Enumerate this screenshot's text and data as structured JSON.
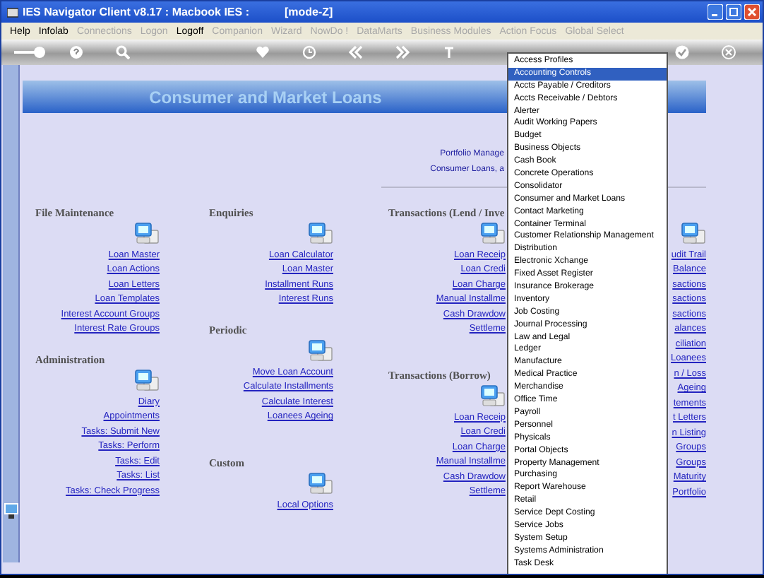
{
  "window": {
    "title": "IES Navigator Client v8.17 : Macbook IES :",
    "mode": "[mode-Z]"
  },
  "menu": [
    {
      "label": "Help",
      "disabled": false
    },
    {
      "label": "Infolab",
      "disabled": false
    },
    {
      "label": "Connections",
      "disabled": true
    },
    {
      "label": "Logon",
      "disabled": true
    },
    {
      "label": "Logoff",
      "disabled": false
    },
    {
      "label": "Companion",
      "disabled": true
    },
    {
      "label": "Wizard",
      "disabled": true
    },
    {
      "label": "NowDo !",
      "disabled": true
    },
    {
      "label": "DataMarts",
      "disabled": true
    },
    {
      "label": "Business Modules",
      "disabled": true
    },
    {
      "label": "Action Focus",
      "disabled": true
    },
    {
      "label": "Global Select",
      "disabled": true
    }
  ],
  "banner": {
    "title": "Consumer and Market Loans"
  },
  "info": [
    "Portfolio Manage",
    "Consumer Loans, a"
  ],
  "columns": [
    {
      "sections": [
        {
          "heading": "File Maintenance",
          "links": [
            "Loan Master",
            "Loan Actions",
            "Loan Letters",
            "Loan Templates",
            "Interest Account Groups",
            "Interest Rate Groups"
          ]
        },
        {
          "heading": "Administration",
          "links": [
            "Diary",
            "Appointments",
            "Tasks: Submit New",
            "Tasks: Perform",
            "Tasks: Edit",
            "Tasks: List",
            "Tasks: Check Progress"
          ]
        }
      ]
    },
    {
      "sections": [
        {
          "heading": "Enquiries",
          "links": [
            "Loan Calculator",
            "Loan Master",
            "Installment Runs",
            "Interest Runs"
          ]
        },
        {
          "heading": "Periodic",
          "links": [
            "Move Loan Account",
            "Calculate Installments",
            "Calculate Interest",
            "Loanees Ageing"
          ]
        },
        {
          "heading": "Custom",
          "links": [
            "Local Options"
          ]
        }
      ]
    },
    {
      "sections": [
        {
          "heading": "Transactions (Lend / Inve",
          "links": [
            "Loan Receip",
            "Loan Credi",
            "Loan Charge",
            "Manual Installme",
            "Cash Drawdow",
            "Settleme"
          ]
        },
        {
          "heading": "Transactions (Borrow)",
          "links": [
            "Loan Receip",
            "Loan Credi",
            "Loan Charge",
            "Manual Installme",
            "Cash Drawdow",
            "Settleme"
          ]
        }
      ]
    },
    {
      "sections": [
        {
          "links": [
            "udit Trail",
            "Balance",
            "sactions",
            "sactions",
            "sactions",
            "alances",
            "ciliation",
            "Loanees",
            "n / Loss",
            "Ageing",
            "tements",
            "t Letters",
            "n Listing",
            "Groups",
            "Groups",
            "Maturity",
            "Portfolio"
          ]
        }
      ]
    }
  ],
  "dropdown": {
    "items": [
      {
        "label": "Access Profiles",
        "selected": false
      },
      {
        "label": "Accounting Controls",
        "selected": true
      },
      {
        "label": "Accts Payable / Creditors",
        "selected": false
      },
      {
        "label": "Accts Receivable / Debtors",
        "selected": false
      },
      {
        "label": "Alerter",
        "selected": false
      },
      {
        "label": "Audit Working Papers",
        "selected": false
      },
      {
        "label": "Budget",
        "selected": false
      },
      {
        "label": "Business Objects",
        "selected": false
      },
      {
        "label": "Cash Book",
        "selected": false
      },
      {
        "label": "Concrete Operations",
        "selected": false
      },
      {
        "label": "Consolidator",
        "selected": false
      },
      {
        "label": "Consumer and Market Loans",
        "selected": false
      },
      {
        "label": "Contact Marketing",
        "selected": false
      },
      {
        "label": "Container Terminal",
        "selected": false
      },
      {
        "label": "Customer Relationship Management",
        "selected": false
      },
      {
        "label": "Distribution",
        "selected": false
      },
      {
        "label": "Electronic Xchange",
        "selected": false
      },
      {
        "label": "Fixed Asset Register",
        "selected": false
      },
      {
        "label": "Insurance Brokerage",
        "selected": false
      },
      {
        "label": "Inventory",
        "selected": false
      },
      {
        "label": "Job Costing",
        "selected": false
      },
      {
        "label": "Journal Processing",
        "selected": false
      },
      {
        "label": "Law and Legal",
        "selected": false
      },
      {
        "label": "Ledger",
        "selected": false
      },
      {
        "label": "Manufacture",
        "selected": false
      },
      {
        "label": "Medical Practice",
        "selected": false
      },
      {
        "label": "Merchandise",
        "selected": false
      },
      {
        "label": "Office Time",
        "selected": false
      },
      {
        "label": "Payroll",
        "selected": false
      },
      {
        "label": "Personnel",
        "selected": false
      },
      {
        "label": "Physicals",
        "selected": false
      },
      {
        "label": "Portal Objects",
        "selected": false
      },
      {
        "label": "Property Management",
        "selected": false
      },
      {
        "label": "Purchasing",
        "selected": false
      },
      {
        "label": "Report Warehouse",
        "selected": false
      },
      {
        "label": "Retail",
        "selected": false
      },
      {
        "label": "Service Dept Costing",
        "selected": false
      },
      {
        "label": "Service Jobs",
        "selected": false
      },
      {
        "label": "System Setup",
        "selected": false
      },
      {
        "label": "Systems Administration",
        "selected": false
      },
      {
        "label": "Task Desk",
        "selected": false
      }
    ]
  }
}
